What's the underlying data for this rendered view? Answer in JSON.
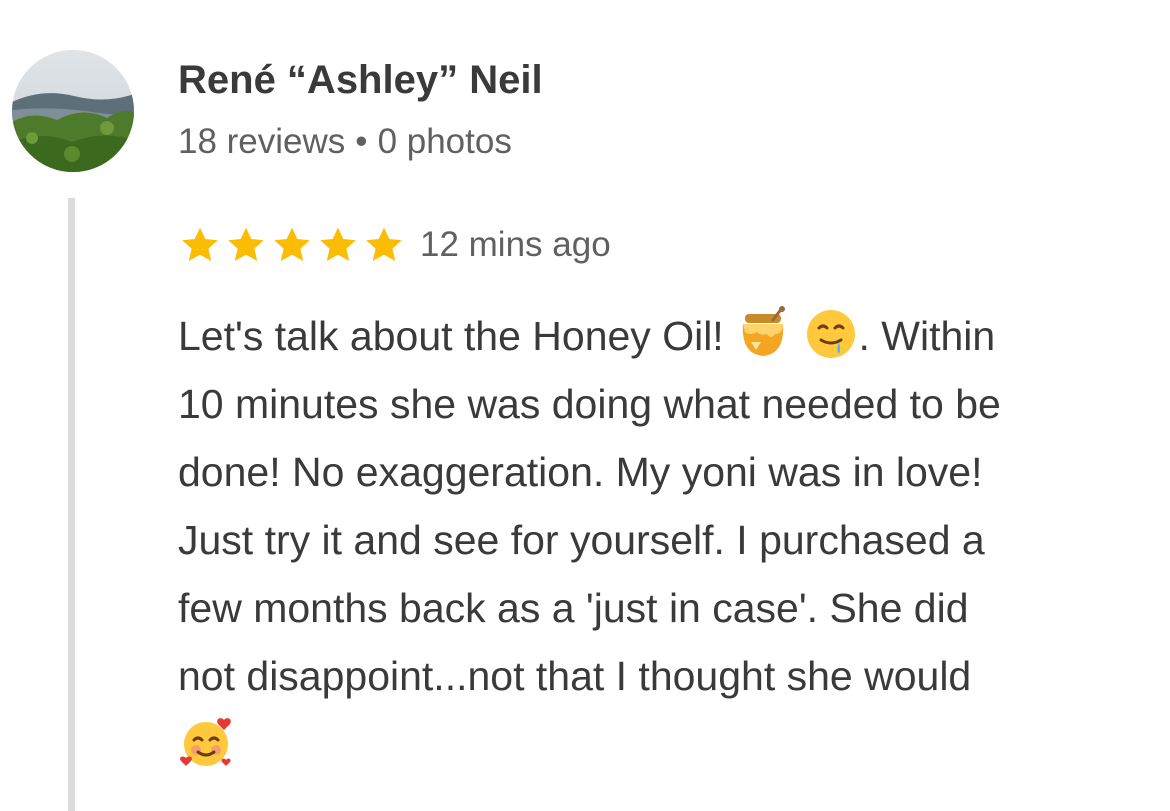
{
  "reviewer": {
    "name": "René “Ashley” Neil",
    "reviews_count": "18 reviews",
    "separator": "•",
    "photos_count": "0 photos",
    "avatar": "landscape-photo-avatar"
  },
  "review": {
    "rating": 5,
    "max_rating": 5,
    "time_ago": "12 mins ago",
    "star_color": "#fbbc04",
    "lines": [
      {
        "pre": "Let's talk about the Honey Oil! ",
        "emoji_1": "honey-pot-emoji",
        "emoji_2": "drooling-face-emoji",
        "post": ". Within"
      },
      {
        "text": "10 minutes she was doing what needed to be"
      },
      {
        "text": "done! No exaggeration. My yoni was in love!"
      },
      {
        "text": "Just try it and see for yourself. I purchased a"
      },
      {
        "text": "few months back as a 'just in case'. She did"
      },
      {
        "text": "not disappoint...not that I thought she would"
      },
      {
        "emoji": "smiling-face-with-hearts-emoji"
      }
    ]
  }
}
